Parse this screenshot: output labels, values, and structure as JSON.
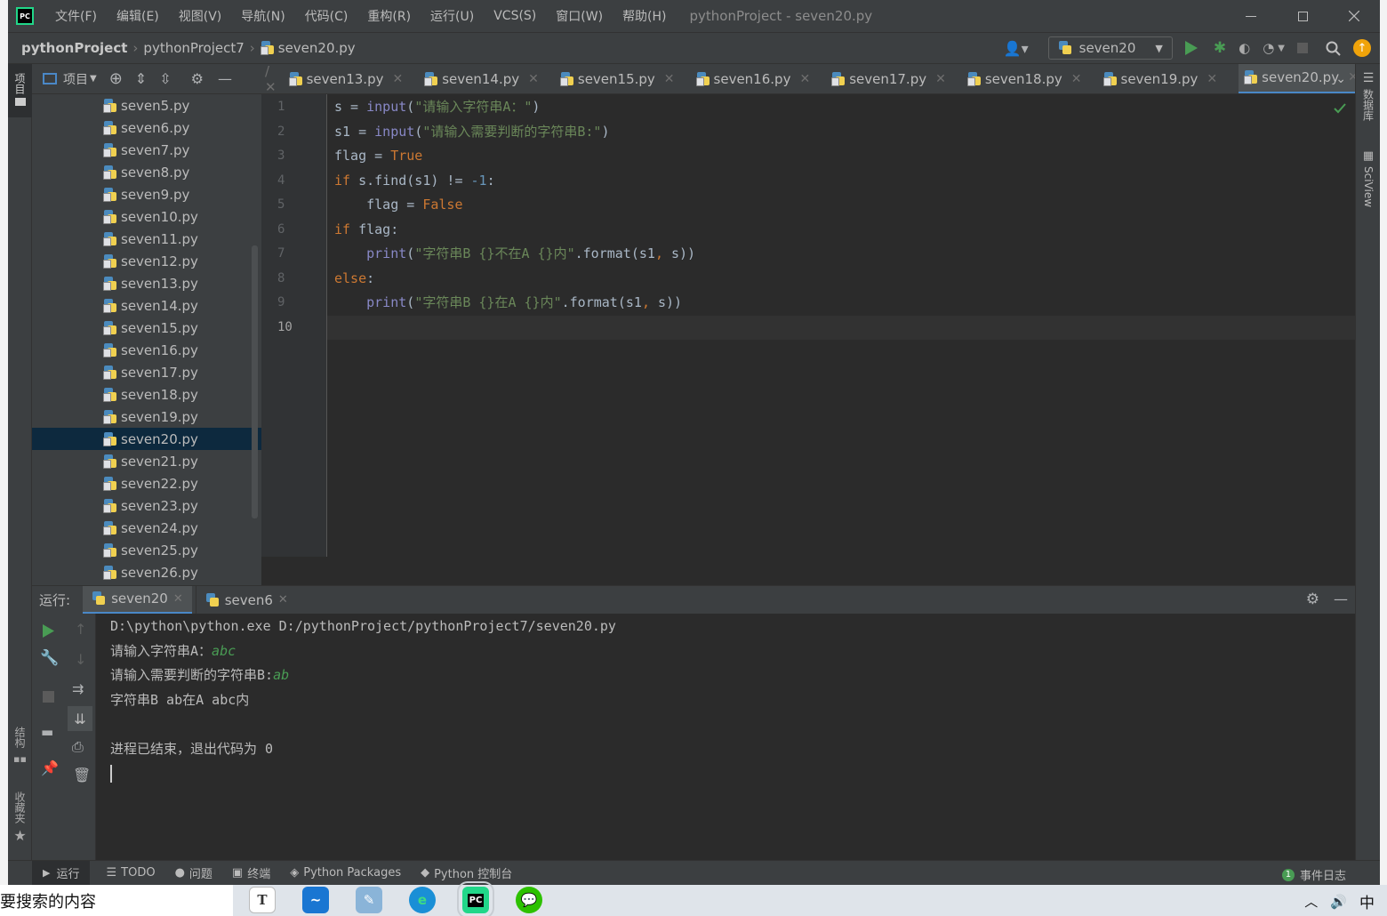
{
  "menu": {
    "logo": "PC",
    "items": [
      "文件(F)",
      "编辑(E)",
      "视图(V)",
      "导航(N)",
      "代码(C)",
      "重构(R)",
      "运行(U)",
      "VCS(S)",
      "窗口(W)",
      "帮助(H)"
    ],
    "title": "pythonProject - seven20.py"
  },
  "breadcrumb": {
    "root": "pythonProject",
    "folder": "pythonProject7",
    "file": "seven20.py"
  },
  "run_config": "seven20",
  "left_strip": {
    "project": "项目",
    "structure": "结构",
    "favorites": "收藏夹"
  },
  "right_strip": {
    "database": "数据库",
    "sciview": "SciView"
  },
  "project_header": {
    "label": "项目"
  },
  "project_files": [
    "seven5.py",
    "seven6.py",
    "seven7.py",
    "seven8.py",
    "seven9.py",
    "seven10.py",
    "seven11.py",
    "seven12.py",
    "seven13.py",
    "seven14.py",
    "seven15.py",
    "seven16.py",
    "seven17.py",
    "seven18.py",
    "seven19.py",
    "seven20.py",
    "seven21.py",
    "seven22.py",
    "seven23.py",
    "seven24.py",
    "seven25.py",
    "seven26.py"
  ],
  "selected_file": "seven20.py",
  "tabs": [
    "seven13.py",
    "seven14.py",
    "seven15.py",
    "seven16.py",
    "seven17.py",
    "seven18.py",
    "seven19.py",
    "seven20.py"
  ],
  "active_tab": "seven20.py",
  "code": {
    "line_numbers": [
      "1",
      "2",
      "3",
      "4",
      "5",
      "6",
      "7",
      "8",
      "9",
      "10"
    ],
    "l1": {
      "a": "s = ",
      "b": "input",
      "c": "(",
      "d": "\"请输入字符串A：\"",
      "e": ")"
    },
    "l2": {
      "a": "s1 = ",
      "b": "input",
      "c": "(",
      "d": "\"请输入需要判断的字符串B:\"",
      "e": ")"
    },
    "l3": {
      "a": "flag = ",
      "b": "True"
    },
    "l4": {
      "a": "if",
      "b": " s.find(s1) != ",
      "c": "-1",
      "d": ":"
    },
    "l5": {
      "a": "    flag = ",
      "b": "False"
    },
    "l6": {
      "a": "if",
      "b": " flag:"
    },
    "l7": {
      "a": "    ",
      "b": "print",
      "c": "(",
      "d": "\"字符串B {}不在A {}内\"",
      "e": ".format(s1",
      "f": ", ",
      "g": "s))"
    },
    "l8": {
      "a": "else",
      "b": ":"
    },
    "l9": {
      "a": "    ",
      "b": "print",
      "c": "(",
      "d": "\"字符串B {}在A {}内\"",
      "e": ".format(s1",
      "f": ", ",
      "g": "s))"
    }
  },
  "run_panel": {
    "label": "运行:",
    "tabs": [
      "seven20",
      "seven6"
    ],
    "output": {
      "cmd": "D:\\python\\python.exe D:/pythonProject/pythonProject7/seven20.py",
      "prompt1": "请输入字符串A：",
      "input1": "abc",
      "prompt2": "请输入需要判断的字符串B:",
      "input2": "ab",
      "result": "字符串B ab在A abc内",
      "exit": "进程已结束，退出代码为 0"
    }
  },
  "bottom_bar": {
    "items": [
      "运行",
      "TODO",
      "问题",
      "终端",
      "Python Packages",
      "Python 控制台"
    ],
    "event_count": "1",
    "event_log": "事件日志"
  },
  "taskbar": {
    "search_text": "要搜索的内容",
    "ime": "中"
  },
  "colors": {
    "accent": "#4a88c7",
    "keyword": "#cc7832",
    "string": "#6a8759",
    "number": "#6897bb",
    "builtin": "#8888c6",
    "run_green": "#499c54"
  }
}
